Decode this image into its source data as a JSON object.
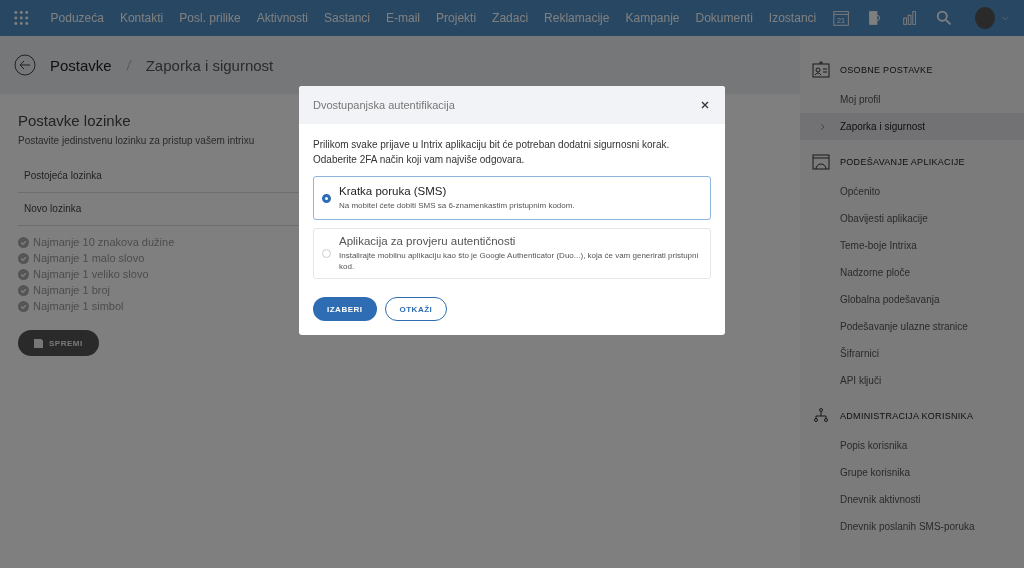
{
  "topbar": {
    "nav": [
      "Poduzeća",
      "Kontakti",
      "Posl. prilike",
      "Aktivnosti",
      "Sastanci",
      "E-mail",
      "Projekti",
      "Zadaci",
      "Reklamacije",
      "Kampanje",
      "Dokumenti",
      "Izostanci"
    ],
    "calendar_day": "21"
  },
  "breadcrumb": {
    "root": "Postavke",
    "current": "Zaporka i sigurnost"
  },
  "password_settings": {
    "title": "Postavke lozinke",
    "subtitle": "Postavite jedinstvenu lozinku za pristup vašem intrixu",
    "fields": [
      {
        "placeholder": "Postojeća lozinka"
      },
      {
        "placeholder": "Novo lozinka"
      }
    ],
    "rules": [
      "Najmanje 10 znakova dužine",
      "Najmanje 1 malo slovo",
      "Najmanje 1 veliko slovo",
      "Najmanje 1 broj",
      "Najmanje 1 simbol"
    ],
    "save_button": "SPREMI"
  },
  "sidebar": {
    "sections": [
      {
        "kind": "person",
        "title": "OSOBNE POSTAVKE",
        "items": [
          {
            "label": "Moj profil",
            "selected": false
          },
          {
            "label": "Zaporka i sigurnost",
            "selected": true
          }
        ]
      },
      {
        "kind": "app",
        "title": "PODEŠAVANJE APLIKACIJE",
        "items": [
          {
            "label": "Općenito",
            "selected": false
          },
          {
            "label": "Obavijesti aplikacije",
            "selected": false
          },
          {
            "label": "Teme-boje Intrixa",
            "selected": false
          },
          {
            "label": "Nadzorne ploče",
            "selected": false
          },
          {
            "label": "Globalna podešavanja",
            "selected": false
          },
          {
            "label": "Podešavanje ulazne stranice",
            "selected": false
          },
          {
            "label": "Šifrarnici",
            "selected": false
          },
          {
            "label": "API ključi",
            "selected": false
          }
        ]
      },
      {
        "kind": "users",
        "title": "ADMINISTRACIJA KORISNIKA",
        "items": [
          {
            "label": "Popis korisnika",
            "selected": false
          },
          {
            "label": "Grupe korisnika",
            "selected": false
          },
          {
            "label": "Dnevnik aktivnosti",
            "selected": false
          },
          {
            "label": "Dnevnik poslanih SMS-poruka",
            "selected": false
          }
        ]
      }
    ]
  },
  "dialog": {
    "title": "Dvostupanjska autentifikacija",
    "intro": "Prilikom svake prijave u Intrix aplikaciju bit će potreban dodatni sigurnosni korak.\nOdaberite 2FA način koji vam najviše odgovara.",
    "options": [
      {
        "title": "Kratka poruka (SMS)",
        "description": "Na mobitel ćete dobiti SMS sa 6-znamenkastim pristupnim kodom.",
        "selected": true
      },
      {
        "title": "Aplikacija za provjeru autentičnosti",
        "description": "Instalirajte mobilnu aplikaciju kao što je Google Authenticator (Duo...), koja će vam generirati pristupni kod.",
        "selected": false
      }
    ],
    "confirm": "IZABERI",
    "cancel": "OTKAŽI"
  }
}
